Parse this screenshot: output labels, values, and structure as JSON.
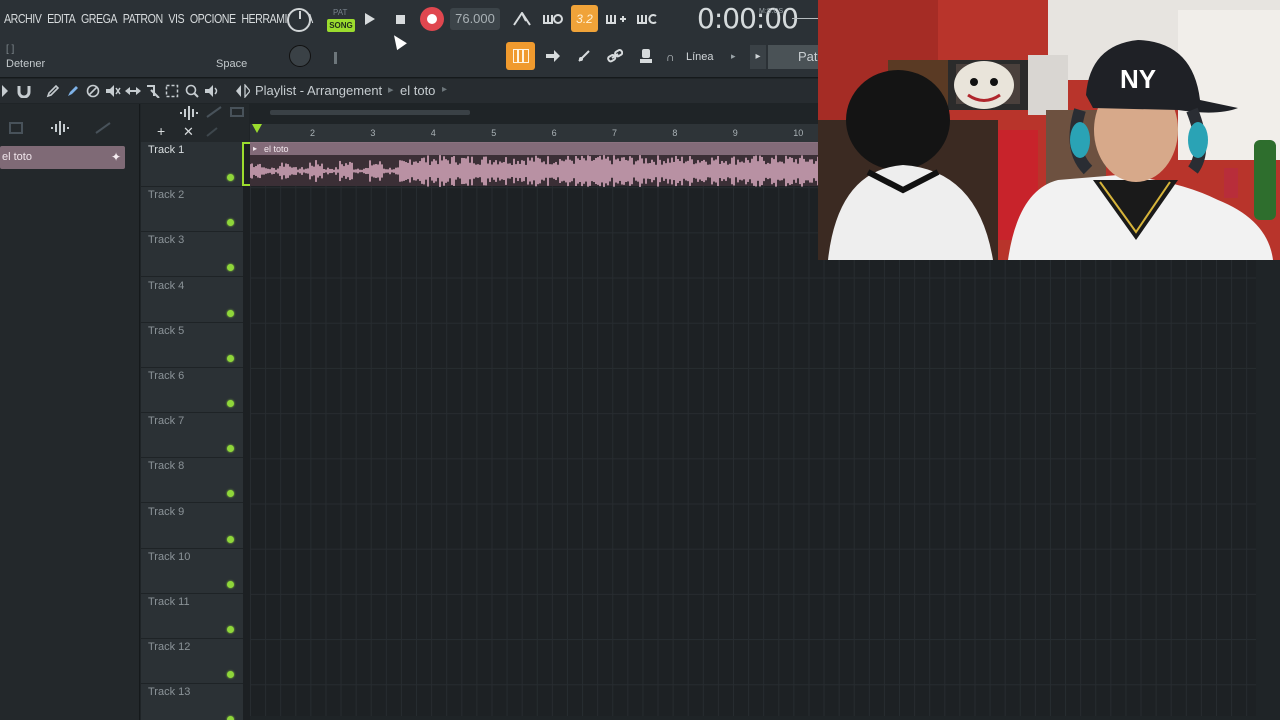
{
  "menu": [
    "ARCHIV",
    "EDITA",
    "GREGA",
    "PATRON",
    "VIS",
    "OPCIONE",
    "HERRAMIENTA"
  ],
  "hint": {
    "bracket": "[ ]",
    "text": "Detener",
    "key": "Space"
  },
  "transport": {
    "pat_label": "PAT",
    "song_label": "SONG",
    "tempo": "76.000",
    "step_label": "3.2",
    "time": "0:00:00",
    "time_unit": "M:S:CS"
  },
  "toolbar2": {
    "snap_label": "Línea",
    "pattern_label": "Patr"
  },
  "playlist": {
    "title": "Playlist - Arrangement",
    "pattern_name": "el toto"
  },
  "picker": {
    "pattern_item": "el toto"
  },
  "ruler": [
    "2",
    "3",
    "4",
    "5",
    "6",
    "7",
    "8",
    "9",
    "10"
  ],
  "tracks": [
    "Track 1",
    "Track 2",
    "Track 3",
    "Track 4",
    "Track 5",
    "Track 6",
    "Track 7",
    "Track 8",
    "Track 9",
    "Track 10",
    "Track 11",
    "Track 12",
    "Track 13"
  ],
  "clip": {
    "name": "el toto"
  },
  "colors": {
    "accent_green": "#9bdc2e",
    "accent_orange": "#f0a339",
    "record_red": "#e0474f",
    "clip_color": "#836b79"
  },
  "icons": [
    "search-icon",
    "magnet-icon",
    "pencil-icon",
    "paint-icon",
    "delete-icon",
    "mute-icon",
    "slip-icon",
    "slice-icon",
    "select-icon",
    "zoom-icon",
    "playback-icon"
  ]
}
